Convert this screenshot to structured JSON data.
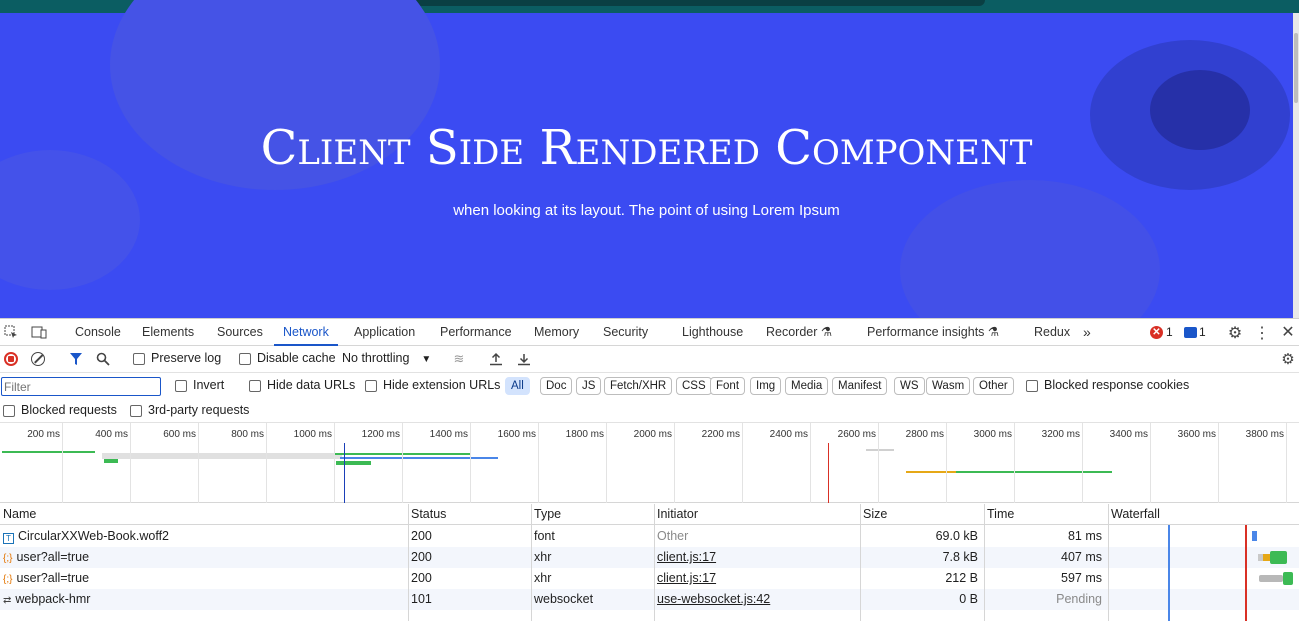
{
  "hero": {
    "title": "Client Side Rendered Component",
    "subtitle": "when looking at its layout. The point of using Lorem Ipsum",
    "bg_color": "#3b4bf2"
  },
  "devtools": {
    "tabs": [
      "Console",
      "Elements",
      "Sources",
      "Network",
      "Application",
      "Performance",
      "Memory",
      "Security",
      "Lighthouse",
      "Recorder",
      "Performance insights",
      "Redux"
    ],
    "active_tab": "Network",
    "error_count": "1",
    "message_count": "1",
    "toolbar": {
      "preserve_log": "Preserve log",
      "disable_cache": "Disable cache",
      "throttling": "No throttling"
    },
    "filter": {
      "placeholder": "Filter",
      "invert": "Invert",
      "hide_data_urls": "Hide data URLs",
      "hide_extension_urls": "Hide extension URLs",
      "types": [
        "All",
        "Doc",
        "JS",
        "Fetch/XHR",
        "CSS",
        "Font",
        "Img",
        "Media",
        "Manifest",
        "WS",
        "Wasm",
        "Other"
      ],
      "active_type": "All",
      "blocked_response_cookies": "Blocked response cookies",
      "blocked_requests": "Blocked requests",
      "third_party_requests": "3rd-party requests"
    },
    "timeline_ticks": [
      "200 ms",
      "400 ms",
      "600 ms",
      "800 ms",
      "1000 ms",
      "1200 ms",
      "1400 ms",
      "1600 ms",
      "1800 ms",
      "2000 ms",
      "2200 ms",
      "2400 ms",
      "2600 ms",
      "2800 ms",
      "3000 ms",
      "3200 ms",
      "3400 ms",
      "3600 ms",
      "3800 ms"
    ],
    "columns": [
      "Name",
      "Status",
      "Type",
      "Initiator",
      "Size",
      "Time",
      "Waterfall"
    ],
    "rows": [
      {
        "name": "CircularXXWeb-Book.woff2",
        "status": "200",
        "type": "font",
        "initiator": "Other",
        "size": "69.0 kB",
        "time": "81 ms",
        "icon": "font-file-icon"
      },
      {
        "name": "user?all=true",
        "status": "200",
        "type": "xhr",
        "initiator": "client.js:17",
        "size": "7.8 kB",
        "time": "407 ms",
        "icon": "xhr-icon"
      },
      {
        "name": "user?all=true",
        "status": "200",
        "type": "xhr",
        "initiator": "client.js:17",
        "size": "212 B",
        "time": "597 ms",
        "icon": "xhr-icon"
      },
      {
        "name": "webpack-hmr",
        "status": "101",
        "type": "websocket",
        "initiator": "use-websocket.js:42",
        "size": "0 B",
        "time": "Pending",
        "icon": "websocket-icon"
      }
    ]
  }
}
